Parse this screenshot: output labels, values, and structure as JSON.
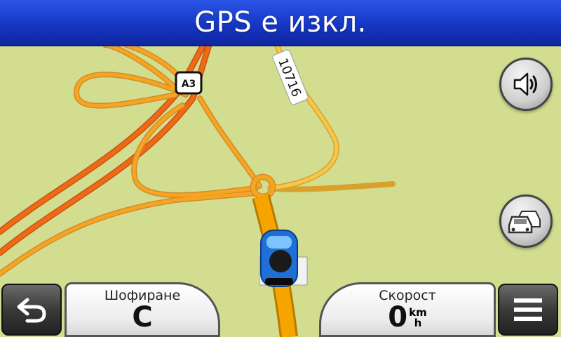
{
  "header": {
    "title": "GPS е изкл."
  },
  "map": {
    "road_label_a3": "A3",
    "road_label_10716": "10716",
    "colors": {
      "background": "#d3dd8f",
      "motorway": "#f06a14",
      "primary": "#f4a623",
      "secondary": "#f6c84a",
      "route": "#f5a400"
    }
  },
  "buttons": {
    "speaker_icon": "speaker-volume-icon",
    "traffic_icon": "traffic-cars-icon",
    "back_icon": "back-arrow-icon",
    "menu_icon": "menu-icon"
  },
  "fields": {
    "left": {
      "label": "Шофиране",
      "value": "С"
    },
    "right": {
      "label": "Скорост",
      "value": "0",
      "unit_top": "km",
      "unit_bottom": "h"
    }
  }
}
